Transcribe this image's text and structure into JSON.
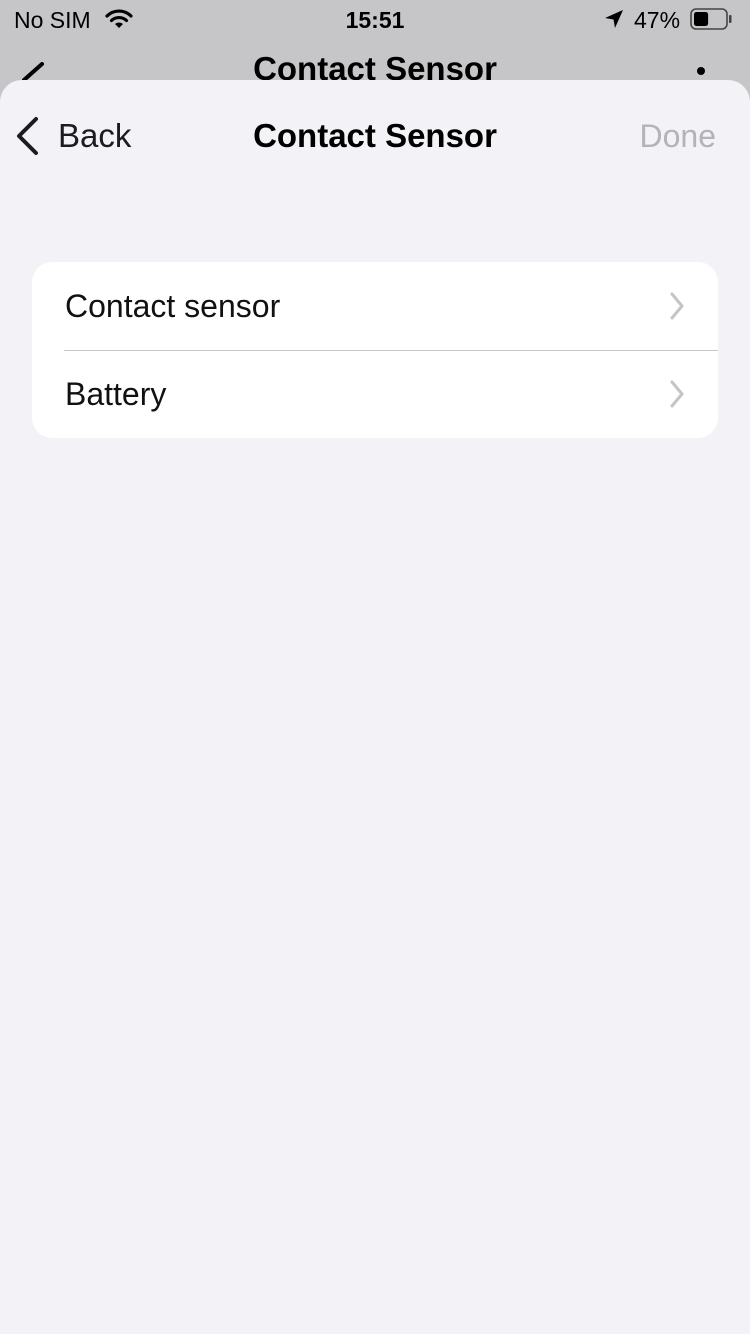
{
  "status_bar": {
    "carrier": "No SIM",
    "time": "15:51",
    "battery_percent": "47%",
    "battery_level": 0.47
  },
  "background_screen": {
    "title": "Contact Sensor"
  },
  "sheet": {
    "back_label": "Back",
    "title": "Contact Sensor",
    "done_label": "Done",
    "items": [
      {
        "label": "Contact sensor"
      },
      {
        "label": "Battery"
      }
    ]
  },
  "colors": {
    "sheet_background": "#f2f2f7",
    "dimmed_background": "#c6c6c8",
    "done_disabled": "#b4b4b8",
    "chevron": "#c4c4c7"
  }
}
